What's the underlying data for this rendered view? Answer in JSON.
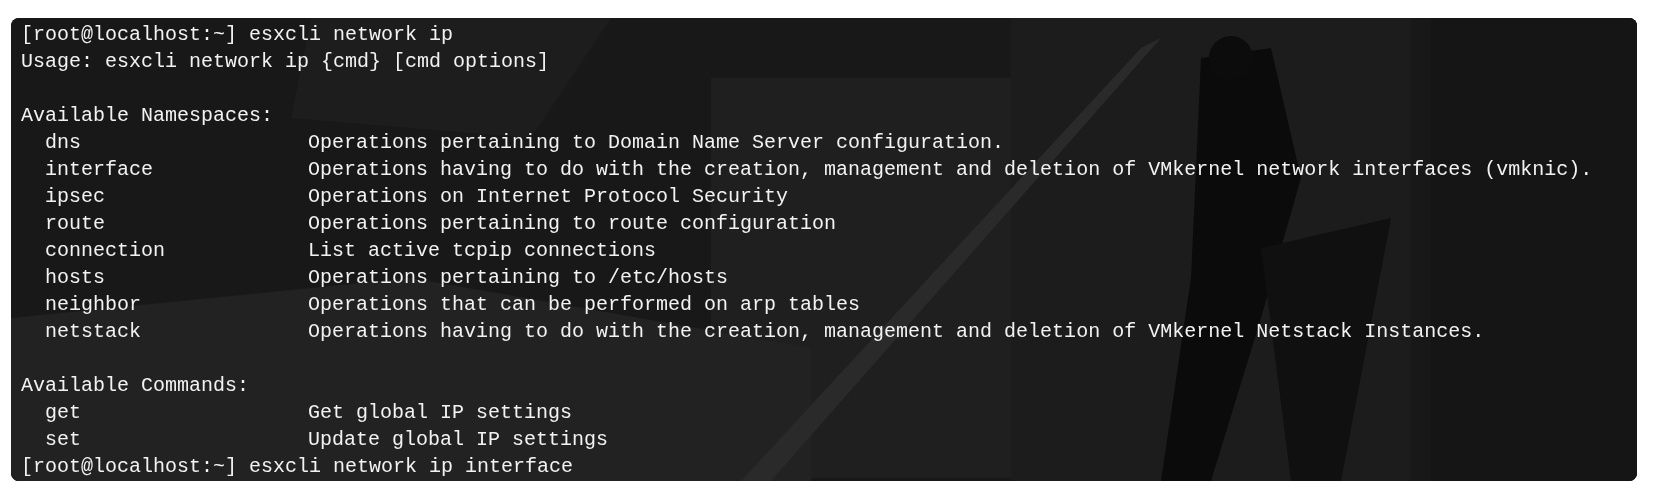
{
  "terminal": {
    "lines": [
      {
        "kind": "prompt",
        "prompt": "[root@localhost:~]",
        "command": "esxcli network ip"
      },
      {
        "kind": "text",
        "text": "Usage: esxcli network ip {cmd} [cmd options]"
      },
      {
        "kind": "blank"
      },
      {
        "kind": "text",
        "text": "Available Namespaces:"
      },
      {
        "kind": "entry",
        "name": "dns",
        "description": "Operations pertaining to Domain Name Server configuration."
      },
      {
        "kind": "entry",
        "name": "interface",
        "description": "Operations having to do with the creation, management and deletion of VMkernel network interfaces (vmknic)."
      },
      {
        "kind": "entry",
        "name": "ipsec",
        "description": "Operations on Internet Protocol Security"
      },
      {
        "kind": "entry",
        "name": "route",
        "description": "Operations pertaining to route configuration"
      },
      {
        "kind": "entry",
        "name": "connection",
        "description": "List active tcpip connections"
      },
      {
        "kind": "entry",
        "name": "hosts",
        "description": "Operations pertaining to /etc/hosts"
      },
      {
        "kind": "entry",
        "name": "neighbor",
        "description": "Operations that can be performed on arp tables"
      },
      {
        "kind": "entry",
        "name": "netstack",
        "description": "Operations having to do with the creation, management and deletion of VMkernel Netstack Instances."
      },
      {
        "kind": "blank"
      },
      {
        "kind": "text",
        "text": "Available Commands:"
      },
      {
        "kind": "entry",
        "name": "get",
        "description": "Get global IP settings"
      },
      {
        "kind": "entry",
        "name": "set",
        "description": "Update global IP settings"
      },
      {
        "kind": "prompt",
        "prompt": "[root@localhost:~]",
        "command": "esxcli network ip interface"
      }
    ]
  }
}
